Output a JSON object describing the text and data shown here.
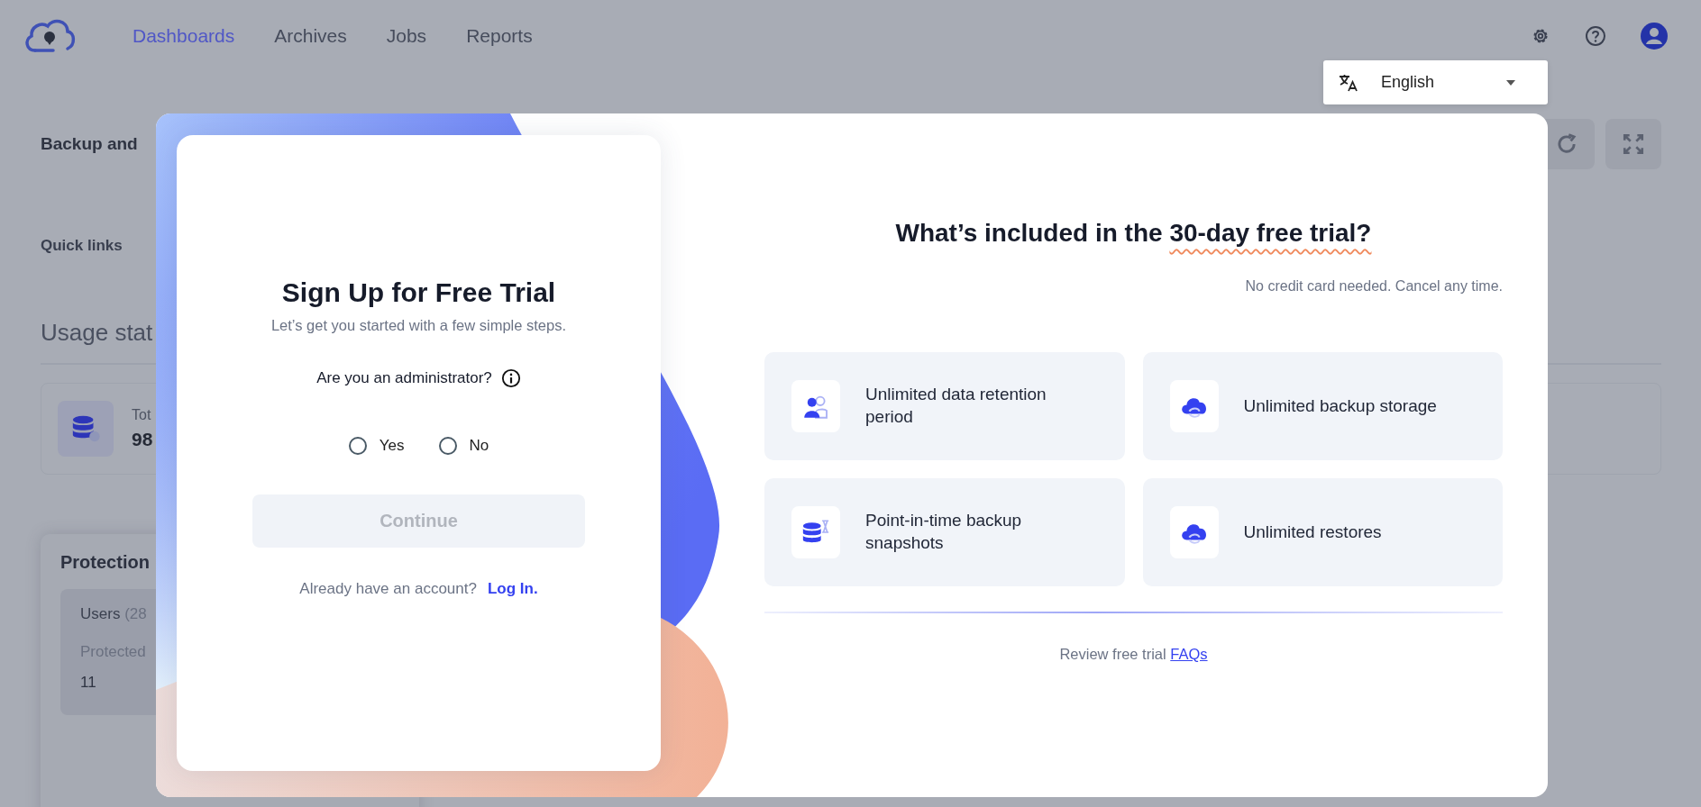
{
  "top_nav": {
    "tabs": [
      {
        "label": "Dashboards",
        "selected": true
      },
      {
        "label": "Archives",
        "selected": false
      },
      {
        "label": "Jobs",
        "selected": false
      },
      {
        "label": "Reports",
        "selected": false
      }
    ]
  },
  "language_select": {
    "value": "English"
  },
  "page": {
    "title": "Backup and",
    "quick_links_label": "Quick links",
    "usage_heading": "Usage stat",
    "usage_card": {
      "label": "Tot",
      "value": "98"
    },
    "protection_card": {
      "title": "Protection",
      "users_label": "Users",
      "users_count": "(28",
      "protected_label": "Protected",
      "protected_value": "11"
    }
  },
  "signup": {
    "title": "Sign Up for Free Trial",
    "subtitle": "Let’s get you started with a few simple steps.",
    "question": "Are you an administrator?",
    "options": [
      {
        "label": "Yes",
        "selected": false
      },
      {
        "label": "No",
        "selected": false
      }
    ],
    "continue_button": {
      "label": "Continue",
      "disabled": true
    },
    "login_prompt": "Already have an account?",
    "login_link": "Log In."
  },
  "trial_info": {
    "title": "What’s included in the",
    "title_highlight": "30-day free trial?",
    "note": "No credit card needed. Cancel any time.",
    "features": [
      {
        "kind": "people",
        "label": "Unlimited data retention period"
      },
      {
        "kind": "cloud",
        "label": "Unlimited backup storage"
      },
      {
        "kind": "database",
        "label": "Point-in-time backup snapshots"
      },
      {
        "kind": "cloud",
        "label": "Unlimited restores"
      }
    ],
    "faq_prompt": "Review free trial",
    "faq_link": "FAQs"
  }
}
